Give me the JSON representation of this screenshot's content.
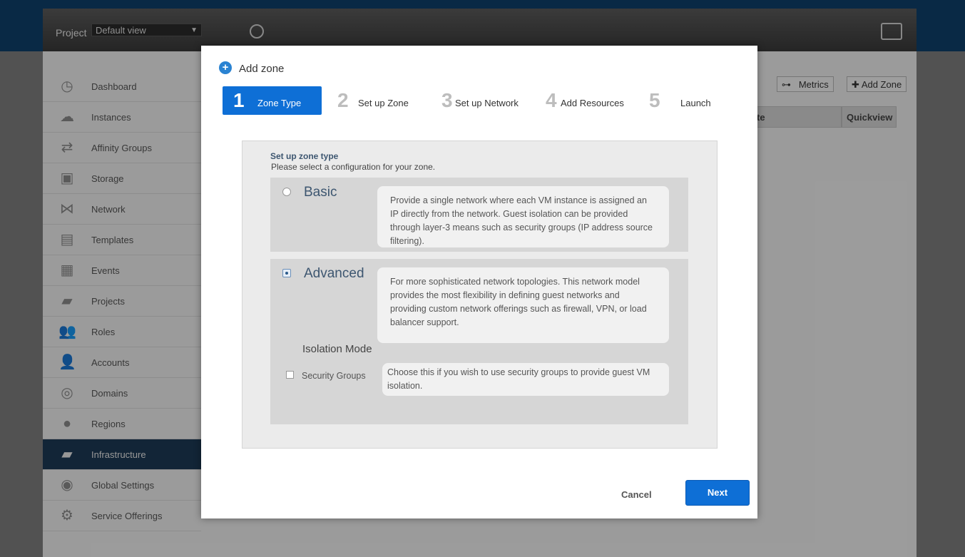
{
  "header": {
    "project_label": "Project",
    "project_select": "Default view"
  },
  "sidebar": {
    "items": [
      {
        "label": "Dashboard",
        "icon": "dashboard-icon"
      },
      {
        "label": "Instances",
        "icon": "cloud-icon"
      },
      {
        "label": "Affinity Groups",
        "icon": "affinity-icon"
      },
      {
        "label": "Storage",
        "icon": "storage-icon"
      },
      {
        "label": "Network",
        "icon": "network-icon"
      },
      {
        "label": "Templates",
        "icon": "templates-icon"
      },
      {
        "label": "Events",
        "icon": "calendar-icon"
      },
      {
        "label": "Projects",
        "icon": "folder-icon"
      },
      {
        "label": "Roles",
        "icon": "roles-icon"
      },
      {
        "label": "Accounts",
        "icon": "user-icon"
      },
      {
        "label": "Domains",
        "icon": "domains-icon"
      },
      {
        "label": "Regions",
        "icon": "globe-icon"
      },
      {
        "label": "Infrastructure",
        "icon": "infrastructure-icon",
        "active": true
      },
      {
        "label": "Global Settings",
        "icon": "globe-settings-icon"
      },
      {
        "label": "Service Offerings",
        "icon": "gear-icon"
      }
    ]
  },
  "toolbar": {
    "metrics_label": "Metrics",
    "add_zone_label": "Add Zone"
  },
  "table": {
    "headers": [
      "te",
      "Quickview"
    ]
  },
  "dialog": {
    "title": "Add zone",
    "steps": [
      {
        "num": "1",
        "label": "Zone Type",
        "active": true
      },
      {
        "num": "2",
        "label": "Set up Zone"
      },
      {
        "num": "3",
        "label": "Set up Network"
      },
      {
        "num": "4",
        "label": "Add Resources"
      },
      {
        "num": "5",
        "label": "Launch"
      }
    ],
    "panel_title": "Set up zone type",
    "panel_subtitle": "Please select a configuration for your zone.",
    "basic": {
      "name": "Basic",
      "desc": "Provide a single network where each VM instance is assigned an IP directly from the network. Guest isolation can be provided through layer-3 means such as security groups (IP address source filtering)."
    },
    "advanced": {
      "name": "Advanced",
      "desc": "For more sophisticated network topologies. This network model provides the most flexibility in defining guest networks and providing custom network offerings such as firewall, VPN, or load balancer support."
    },
    "isolation": {
      "title": "Isolation Mode",
      "security_groups_label": "Security Groups",
      "security_groups_desc": "Choose this if you wish to use security groups to provide guest VM isolation."
    },
    "cancel_label": "Cancel",
    "next_label": "Next"
  }
}
